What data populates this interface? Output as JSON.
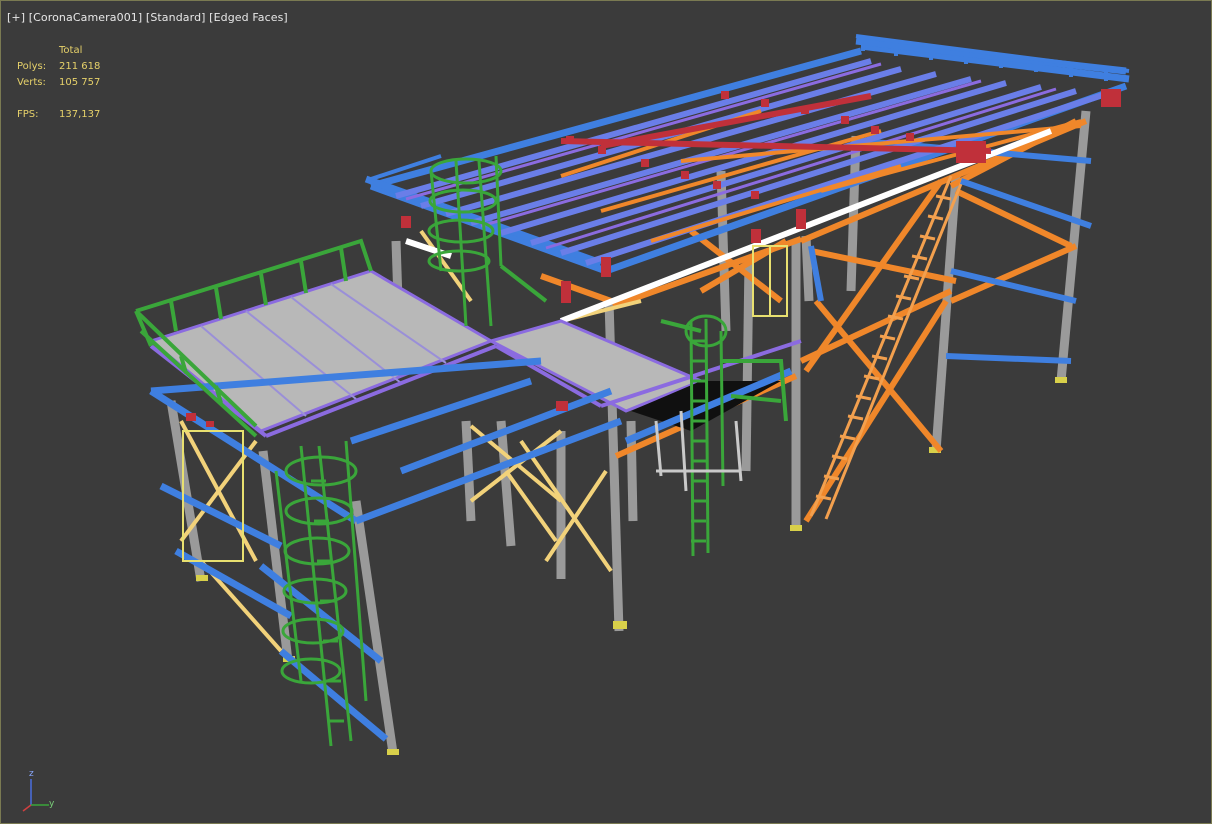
{
  "viewport": {
    "menu": "[+]",
    "camera": "[CoronaCamera001]",
    "shading": "[Standard]",
    "mode": "[Edged Faces]"
  },
  "stats": {
    "header": "Total",
    "polys_label": "Polys:",
    "polys_value": "211 618",
    "verts_label": "Verts:",
    "verts_value": "105 757",
    "fps_label": "FPS:",
    "fps_value": "137,137"
  },
  "axis": {
    "z": "z",
    "y": "y"
  },
  "colors": {
    "background": "#3b3b3b",
    "stats_text": "#e6d16a",
    "column_gray": "#a9a9a9",
    "beam_blue": "#3f7fe0",
    "beam_purple": "#8b6be0",
    "brace_orange": "#f0872a",
    "brace_yellow": "#f2d27a",
    "rail_green": "#3aa63a",
    "base_red": "#c0303a",
    "deck_gray": "#b8b8b8"
  },
  "icons": [
    "axis-gizmo-icon"
  ]
}
